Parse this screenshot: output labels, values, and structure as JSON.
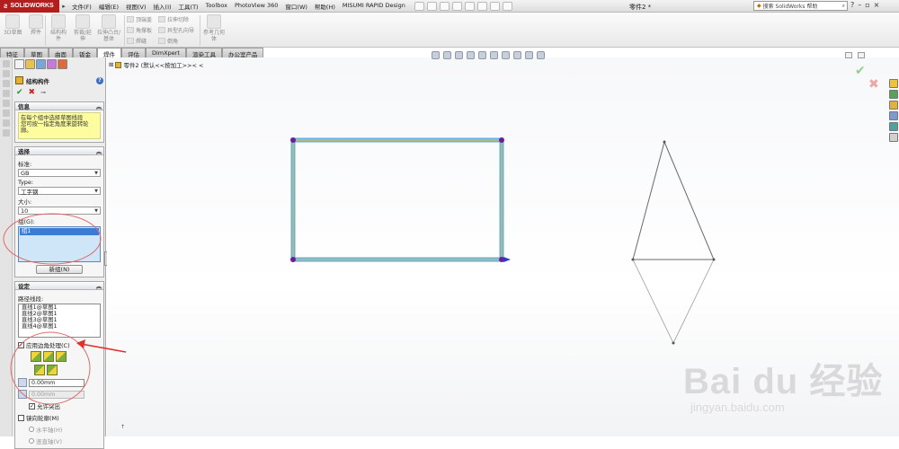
{
  "titlebar": {
    "logo": "SOLIDWORKS",
    "menus": [
      "文件(F)",
      "编辑(E)",
      "视图(V)",
      "插入(I)",
      "工具(T)",
      "Toolbox",
      "PhotoView 360",
      "窗口(W)",
      "帮助(H)",
      "MISUMI RAPID Design"
    ],
    "document_title": "零件2 *",
    "search_placeholder": "搜索 SolidWorks 帮助"
  },
  "ribbon": {
    "buttons": [
      "3D草图",
      "焊件",
      "结构构件",
      "剪裁/延伸",
      "拉伸凸台/基体"
    ],
    "small_items": [
      "顶端盖",
      "角撑板",
      "焊缝",
      "拉伸切除",
      "异型孔向导",
      "倒角"
    ],
    "ref_geometry": "参考几何体"
  },
  "tabs": [
    "特征",
    "草图",
    "曲面",
    "钣金",
    "焊件",
    "评估",
    "DimXpert",
    "渲染工具",
    "办公室产品"
  ],
  "active_tab": "焊件",
  "feature_manager": {
    "title": "结构构件",
    "info_header": "信息",
    "info_text": "在每个组中选择草图线段\n您可按一指定角度来旋转轮廓。",
    "selection_header": "选择",
    "standard_label": "标准:",
    "standard_value": "GB",
    "type_label": "Type:",
    "type_value": "工字钢",
    "size_label": "大小:",
    "size_value": "10",
    "groups_label": "组(G):",
    "group_item": "组1",
    "new_group_button": "新组(N)",
    "settings_header": "设定",
    "path_segments_label": "路径线段:",
    "path_segments": [
      "直线1@草图1",
      "直线2@草图1",
      "直线3@草图1",
      "直线4@草图1"
    ],
    "apply_corner_label": "应用边角处理(C)",
    "gap1_value": "0.00mm",
    "gap2_value": "0.00mm",
    "allow_protrusion_label": "允许突出",
    "mirror_profile_label": "镜向轮廓(M)",
    "horizontal_axis_label": "水平轴(H)",
    "vertical_axis_label": "竖直轴(V)"
  },
  "canvas": {
    "tree_label": "零件2 (默认<<按加工>>< <"
  },
  "watermark": {
    "big": "Bai du 经验",
    "small": "jingyan.baidu.com"
  },
  "colors": {
    "logo_red": "#b01e1e",
    "frame_blue": "#6ab0e0",
    "frame_yellow": "#d8c44a",
    "vertex_purple": "#6a1e9a",
    "ok_green": "#1e9a28",
    "cancel_red": "#c62828",
    "annotation_red": "#e03030",
    "selection_blue": "#3a7bd5"
  }
}
